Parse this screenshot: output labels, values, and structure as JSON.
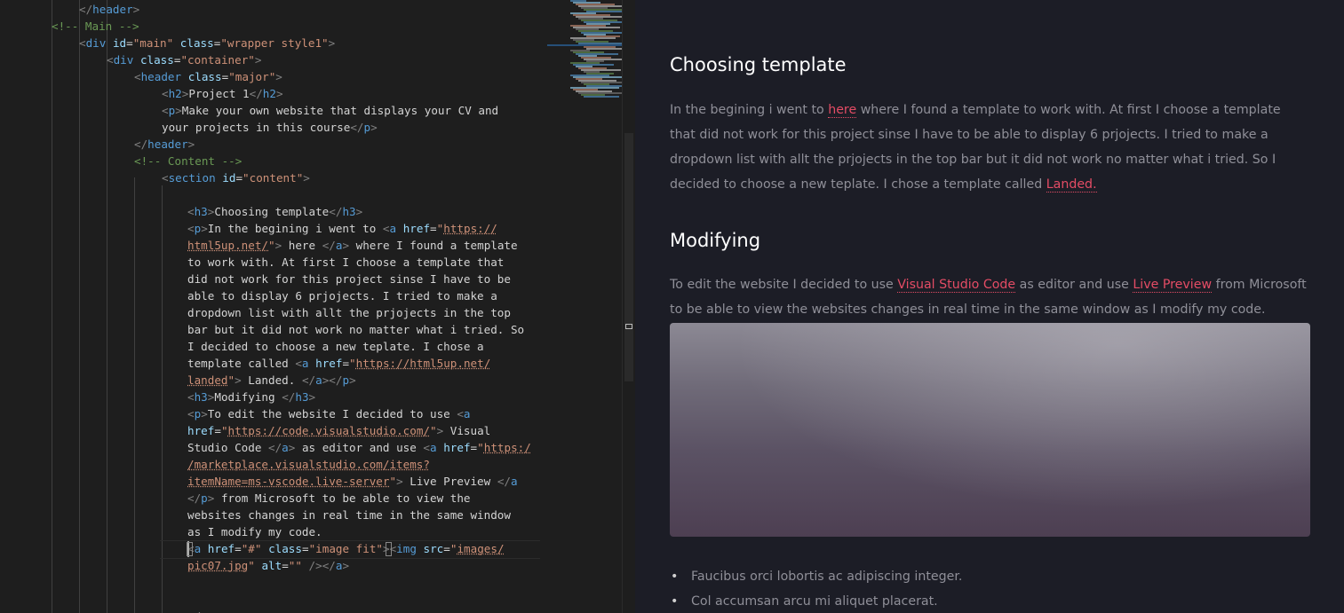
{
  "editor": {
    "lines": [
      [
        [
          "</",
          "tag"
        ],
        [
          "header",
          "name"
        ],
        [
          ">",
          "tag"
        ]
      ],
      [
        [
          "<!-- Main -->",
          "cmt"
        ]
      ],
      [
        [
          "<",
          "tag"
        ],
        [
          "div",
          "name"
        ],
        [
          " ",
          "text"
        ],
        [
          "id",
          "attr"
        ],
        [
          "=",
          "text"
        ],
        [
          "\"main\"",
          "val"
        ],
        [
          " ",
          "text"
        ],
        [
          "class",
          "attr"
        ],
        [
          "=",
          "text"
        ],
        [
          "\"wrapper style1\"",
          "val"
        ],
        [
          ">",
          "tag"
        ]
      ],
      [
        [
          "<",
          "tag"
        ],
        [
          "div",
          "name"
        ],
        [
          " ",
          "text"
        ],
        [
          "class",
          "attr"
        ],
        [
          "=",
          "text"
        ],
        [
          "\"container\"",
          "val"
        ],
        [
          ">",
          "tag"
        ]
      ],
      [
        [
          "<",
          "tag"
        ],
        [
          "header",
          "name"
        ],
        [
          " ",
          "text"
        ],
        [
          "class",
          "attr"
        ],
        [
          "=",
          "text"
        ],
        [
          "\"major\"",
          "val"
        ],
        [
          ">",
          "tag"
        ]
      ],
      [
        [
          "<",
          "tag"
        ],
        [
          "h2",
          "name"
        ],
        [
          ">",
          "tag"
        ],
        [
          "Project 1",
          "text"
        ],
        [
          "</",
          "tag"
        ],
        [
          "h2",
          "name"
        ],
        [
          ">",
          "tag"
        ]
      ],
      [
        [
          "<",
          "tag"
        ],
        [
          "p",
          "name"
        ],
        [
          ">",
          "tag"
        ],
        [
          "Make your own website that displays your CV and",
          "text"
        ]
      ],
      [
        [
          "your projects in this course",
          "text"
        ],
        [
          "</",
          "tag"
        ],
        [
          "p",
          "name"
        ],
        [
          ">",
          "tag"
        ]
      ],
      [
        [
          "</",
          "tag"
        ],
        [
          "header",
          "name"
        ],
        [
          ">",
          "tag"
        ]
      ],
      [
        [
          "<!-- Content -->",
          "cmt"
        ]
      ],
      [
        [
          "<",
          "tag"
        ],
        [
          "section",
          "name"
        ],
        [
          " ",
          "text"
        ],
        [
          "id",
          "attr"
        ],
        [
          "=",
          "text"
        ],
        [
          "\"content\"",
          "val"
        ],
        [
          ">",
          "tag"
        ]
      ],
      [],
      [
        [
          "<",
          "tag"
        ],
        [
          "h3",
          "name"
        ],
        [
          ">",
          "tag"
        ],
        [
          "Choosing template",
          "text"
        ],
        [
          "</",
          "tag"
        ],
        [
          "h3",
          "name"
        ],
        [
          ">",
          "tag"
        ]
      ],
      [
        [
          "<",
          "tag"
        ],
        [
          "p",
          "name"
        ],
        [
          ">",
          "tag"
        ],
        [
          "In the begining i went to ",
          "text"
        ],
        [
          "<",
          "tag"
        ],
        [
          "a",
          "name"
        ],
        [
          " ",
          "text"
        ],
        [
          "href",
          "attr"
        ],
        [
          "=",
          "text"
        ],
        [
          "\"",
          "val"
        ],
        [
          "https://",
          "url"
        ]
      ],
      [
        [
          "html5up.net/",
          "url"
        ],
        [
          "\"",
          "val"
        ],
        [
          ">",
          "tag"
        ],
        [
          " here ",
          "text"
        ],
        [
          "</",
          "tag"
        ],
        [
          "a",
          "name"
        ],
        [
          ">",
          "tag"
        ],
        [
          " where I found a template",
          "text"
        ]
      ],
      [
        [
          "to work with. At first I choose a template that",
          "text"
        ]
      ],
      [
        [
          "did not work for this project sinse I have to be",
          "text"
        ]
      ],
      [
        [
          "able to display 6 prjojects. I tried to make a",
          "text"
        ]
      ],
      [
        [
          "dropdown list with allt the prjojects in the top",
          "text"
        ]
      ],
      [
        [
          "bar but it did not work no matter what i tried. So",
          "text"
        ]
      ],
      [
        [
          "I decided to choose a new teplate. I chose a",
          "text"
        ]
      ],
      [
        [
          "template called ",
          "text"
        ],
        [
          "<",
          "tag"
        ],
        [
          "a",
          "name"
        ],
        [
          " ",
          "text"
        ],
        [
          "href",
          "attr"
        ],
        [
          "=",
          "text"
        ],
        [
          "\"",
          "val"
        ],
        [
          "https://html5up.net/",
          "url"
        ]
      ],
      [
        [
          "landed",
          "url"
        ],
        [
          "\"",
          "val"
        ],
        [
          ">",
          "tag"
        ],
        [
          " Landed. ",
          "text"
        ],
        [
          "</",
          "tag"
        ],
        [
          "a",
          "name"
        ],
        [
          ">",
          "tag"
        ],
        [
          "</",
          "tag"
        ],
        [
          "p",
          "name"
        ],
        [
          ">",
          "tag"
        ]
      ],
      [
        [
          "<",
          "tag"
        ],
        [
          "h3",
          "name"
        ],
        [
          ">",
          "tag"
        ],
        [
          "Modifying ",
          "text"
        ],
        [
          "</",
          "tag"
        ],
        [
          "h3",
          "name"
        ],
        [
          ">",
          "tag"
        ]
      ],
      [
        [
          "<",
          "tag"
        ],
        [
          "p",
          "name"
        ],
        [
          ">",
          "tag"
        ],
        [
          "To edit the website I decided to use ",
          "text"
        ],
        [
          "<",
          "tag"
        ],
        [
          "a",
          "name"
        ]
      ],
      [
        [
          "href",
          "attr"
        ],
        [
          "=",
          "text"
        ],
        [
          "\"",
          "val"
        ],
        [
          "https://code.visualstudio.com/",
          "url"
        ],
        [
          "\"",
          "val"
        ],
        [
          ">",
          "tag"
        ],
        [
          " Visual",
          "text"
        ]
      ],
      [
        [
          "Studio Code ",
          "text"
        ],
        [
          "</",
          "tag"
        ],
        [
          "a",
          "name"
        ],
        [
          ">",
          "tag"
        ],
        [
          " as editor and use ",
          "text"
        ],
        [
          "<",
          "tag"
        ],
        [
          "a",
          "name"
        ],
        [
          " ",
          "text"
        ],
        [
          "href",
          "attr"
        ],
        [
          "=",
          "text"
        ],
        [
          "\"",
          "val"
        ],
        [
          "https:/",
          "url"
        ]
      ],
      [
        [
          "/marketplace.visualstudio.com/items?",
          "url"
        ]
      ],
      [
        [
          "itemName=ms-vscode.live-server",
          "url"
        ],
        [
          "\"",
          "val"
        ],
        [
          ">",
          "tag"
        ],
        [
          " Live Preview ",
          "text"
        ],
        [
          "</",
          "tag"
        ],
        [
          "a",
          "name"
        ]
      ],
      [
        [
          "</",
          "tag"
        ],
        [
          "p",
          "name"
        ],
        [
          ">",
          "tag"
        ],
        [
          " from Microsoft to be able to view the",
          "text"
        ]
      ],
      [
        [
          "websites changes in real time in the same window",
          "text"
        ]
      ],
      [
        [
          "as I modify my code.",
          "text"
        ]
      ],
      [
        [
          "<",
          "tag"
        ],
        [
          "a",
          "name"
        ],
        [
          " ",
          "text"
        ],
        [
          "href",
          "attr"
        ],
        [
          "=",
          "text"
        ],
        [
          "\"#\"",
          "val"
        ],
        [
          " ",
          "text"
        ],
        [
          "class",
          "attr"
        ],
        [
          "=",
          "text"
        ],
        [
          "\"image fit\"",
          "val"
        ],
        [
          ">",
          "tag"
        ],
        [
          "<",
          "tag"
        ],
        [
          "img",
          "name"
        ],
        [
          " ",
          "text"
        ],
        [
          "src",
          "attr"
        ],
        [
          "=",
          "text"
        ],
        [
          "\"",
          "val"
        ],
        [
          "images/",
          "url"
        ]
      ],
      [
        [
          "pic07.jpg",
          "url"
        ],
        [
          "\"",
          "val"
        ],
        [
          " ",
          "text"
        ],
        [
          "alt",
          "attr"
        ],
        [
          "=",
          "text"
        ],
        [
          "\"\"",
          "val"
        ],
        [
          " />",
          "tag"
        ],
        [
          "</",
          "tag"
        ],
        [
          "a",
          "name"
        ],
        [
          ">",
          "tag"
        ]
      ],
      [],
      [],
      [
        [
          "<",
          "tag"
        ],
        [
          "/",
          "tag"
        ]
      ]
    ]
  },
  "preview": {
    "section1": {
      "title": "Choosing template",
      "p_before_link1": "In the begining i went to ",
      "link1": "here",
      "p_after_link1": " where I found a template to work with. At first I choose a template that did not work for this project sinse I have to be able to display 6 prjojects. I tried to make a dropdown list with allt the prjojects in the top bar but it did not work no matter what i tried. So I decided to choose a new teplate. I chose a template called ",
      "link2": "Landed."
    },
    "section2": {
      "title": "Modifying",
      "p_before_link1": "To edit the website I decided to use ",
      "link1": "Visual Studio Code",
      "p_mid": " as editor and use ",
      "link2": "Live Preview",
      "p_after": " from Microsoft to be able to view the websites changes in real time in the same window as I modify my code."
    },
    "list": [
      "Faucibus orci lobortis ac adipiscing integer.",
      "Col accumsan arcu mi aliquet placerat."
    ]
  },
  "colors": {
    "editor_bg": "#1e1e1e",
    "preview_bg": "#1c1d26",
    "link": "#e44c65",
    "tag_name": "#569cd6",
    "attribute": "#9cdcfe",
    "string": "#ce9178",
    "comment": "#6a9955"
  }
}
